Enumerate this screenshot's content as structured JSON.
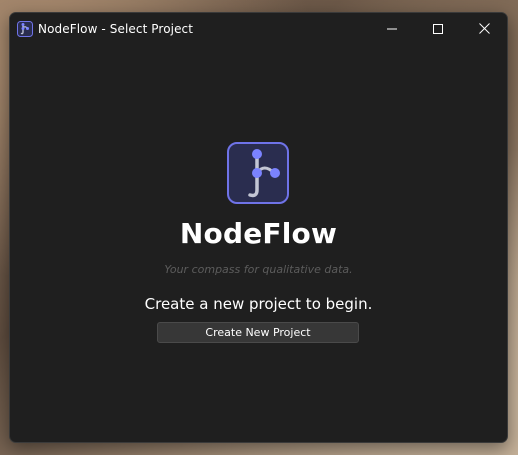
{
  "window": {
    "title": "NodeFlow - Select Project",
    "controls": {
      "minimize_icon": "minimize-icon",
      "maximize_icon": "maximize-icon",
      "close_icon": "close-icon"
    }
  },
  "main": {
    "logo_icon": "nodeflow-logo-icon",
    "app_name": "NodeFlow",
    "tagline": "Your compass for qualitative data.",
    "prompt": "Create a new project to begin.",
    "create_button_label": "Create New Project"
  },
  "colors": {
    "window_bg": "#1f1f1f",
    "logo_border": "#6f73e8",
    "logo_bg": "#2a2d4f",
    "node_fill": "#7b83ff",
    "button_bg": "#373737",
    "tagline": "#5c5c5c"
  }
}
